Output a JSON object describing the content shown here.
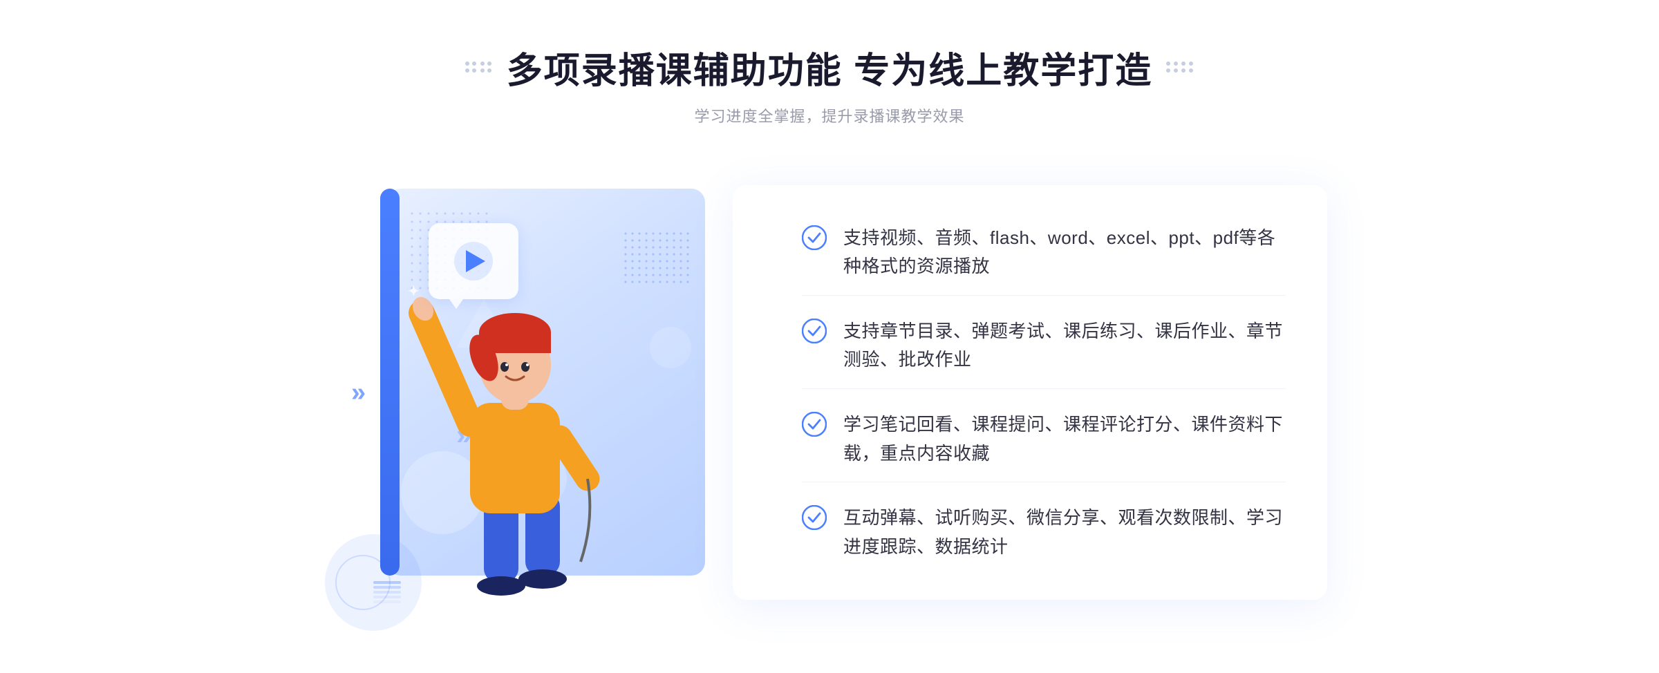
{
  "header": {
    "title": "多项录播课辅助功能 专为线上教学打造",
    "subtitle": "学习进度全掌握，提升录播课教学效果",
    "decorator_left": "decorative-dots",
    "decorator_right": "decorative-dots"
  },
  "features": [
    {
      "id": 1,
      "text": "支持视频、音频、flash、word、excel、ppt、pdf等各种格式的资源播放"
    },
    {
      "id": 2,
      "text": "支持章节目录、弹题考试、课后练习、课后作业、章节测验、批改作业"
    },
    {
      "id": 3,
      "text": "学习笔记回看、课程提问、课程评论打分、课件资料下载，重点内容收藏"
    },
    {
      "id": 4,
      "text": "互动弹幕、试听购买、微信分享、观看次数限制、学习进度跟踪、数据统计"
    }
  ],
  "colors": {
    "primary": "#4a7fff",
    "title": "#1a1a2e",
    "subtitle": "#999aaa",
    "feature_text": "#333344",
    "check_color": "#4a7fff",
    "card_bg": "#ffffff",
    "illustration_bg": "#dbe8ff"
  },
  "illustration": {
    "play_button": "▶",
    "chevron": "»"
  }
}
